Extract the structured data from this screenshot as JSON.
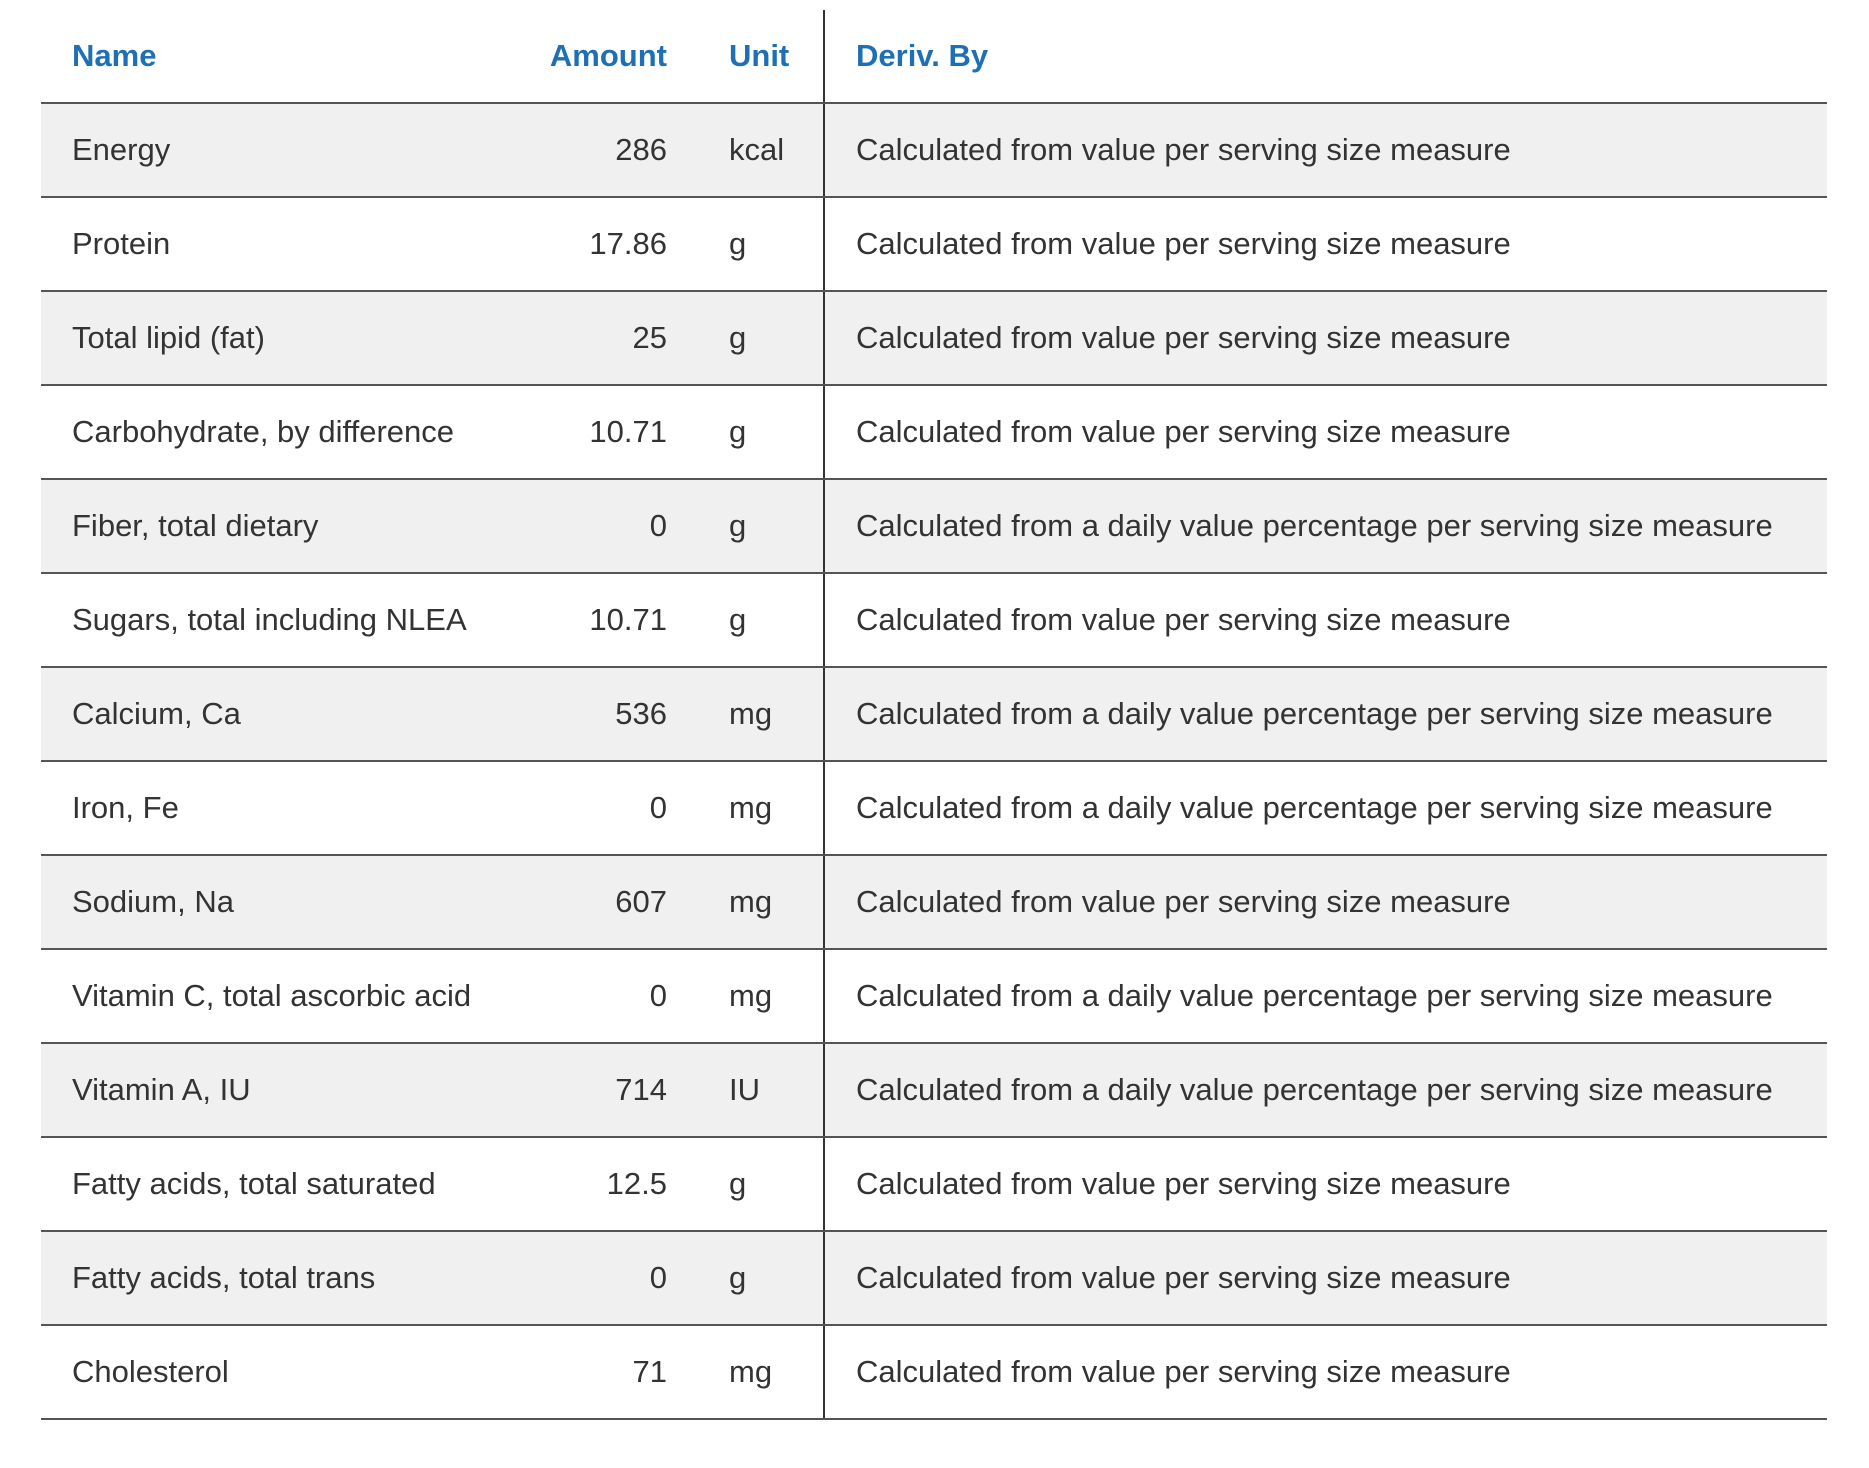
{
  "table": {
    "headers": {
      "name": "Name",
      "amount": "Amount",
      "unit": "Unit",
      "deriv": "Deriv. By"
    },
    "rows": [
      {
        "name": "Energy",
        "amount": "286",
        "unit": "kcal",
        "deriv": "Calculated from value per serving size measure"
      },
      {
        "name": "Protein",
        "amount": "17.86",
        "unit": "g",
        "deriv": "Calculated from value per serving size measure"
      },
      {
        "name": "Total lipid (fat)",
        "amount": "25",
        "unit": "g",
        "deriv": "Calculated from value per serving size measure"
      },
      {
        "name": "Carbohydrate, by difference",
        "amount": "10.71",
        "unit": "g",
        "deriv": "Calculated from value per serving size measure"
      },
      {
        "name": "Fiber, total dietary",
        "amount": "0",
        "unit": "g",
        "deriv": "Calculated from a daily value percentage per serving size measure"
      },
      {
        "name": "Sugars, total including NLEA",
        "amount": "10.71",
        "unit": "g",
        "deriv": "Calculated from value per serving size measure"
      },
      {
        "name": "Calcium, Ca",
        "amount": "536",
        "unit": "mg",
        "deriv": "Calculated from a daily value percentage per serving size measure"
      },
      {
        "name": "Iron, Fe",
        "amount": "0",
        "unit": "mg",
        "deriv": "Calculated from a daily value percentage per serving size measure"
      },
      {
        "name": "Sodium, Na",
        "amount": "607",
        "unit": "mg",
        "deriv": "Calculated from value per serving size measure"
      },
      {
        "name": "Vitamin C, total ascorbic acid",
        "amount": "0",
        "unit": "mg",
        "deriv": "Calculated from a daily value percentage per serving size measure"
      },
      {
        "name": "Vitamin A, IU",
        "amount": "714",
        "unit": "IU",
        "deriv": "Calculated from a daily value percentage per serving size measure"
      },
      {
        "name": "Fatty acids, total saturated",
        "amount": "12.5",
        "unit": "g",
        "deriv": "Calculated from value per serving size measure"
      },
      {
        "name": "Fatty acids, total trans",
        "amount": "0",
        "unit": "g",
        "deriv": "Calculated from value per serving size measure"
      },
      {
        "name": "Cholesterol",
        "amount": "71",
        "unit": "mg",
        "deriv": "Calculated from value per serving size measure"
      }
    ]
  },
  "colors": {
    "header_text": "#1f6fb5",
    "stripe": "#f0f0f0"
  }
}
